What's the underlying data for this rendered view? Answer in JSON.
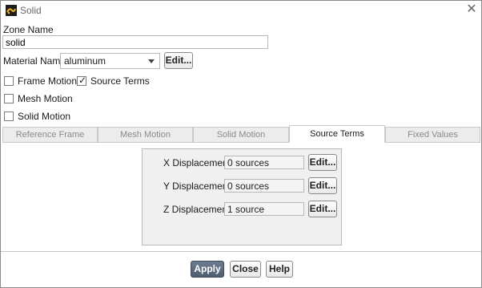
{
  "window": {
    "title": "Solid",
    "close_glyph": "✕",
    "icon": "app-logo-icon"
  },
  "zone_name": {
    "label": "Zone Name",
    "value": "solid"
  },
  "material": {
    "label": "Material Name",
    "value": "aluminum",
    "edit_label": "Edit..."
  },
  "checkboxes": {
    "frame_motion": {
      "label": "Frame Motion",
      "checked": false
    },
    "source_terms": {
      "label": "Source Terms",
      "checked": true
    },
    "mesh_motion": {
      "label": "Mesh Motion",
      "checked": false
    },
    "solid_motion": {
      "label": "Solid Motion",
      "checked": false
    }
  },
  "tabs": [
    {
      "label": "Reference Frame",
      "active": false
    },
    {
      "label": "Mesh Motion",
      "active": false
    },
    {
      "label": "Solid Motion",
      "active": false
    },
    {
      "label": "Source Terms",
      "active": true
    },
    {
      "label": "Fixed Values",
      "active": false
    }
  ],
  "sources": [
    {
      "label": "X Displacement",
      "value": "0 sources",
      "edit_label": "Edit..."
    },
    {
      "label": "Y Displacement",
      "value": "0 sources",
      "edit_label": "Edit..."
    },
    {
      "label": "Z Displacement",
      "value": "1 source",
      "edit_label": "Edit..."
    }
  ],
  "footer": {
    "apply_label": "Apply",
    "close_label": "Close",
    "help_label": "Help"
  },
  "colors": {
    "primary_button": "#56647a",
    "active_tab": "#ffffff",
    "inactive_tab": "#ececec"
  }
}
